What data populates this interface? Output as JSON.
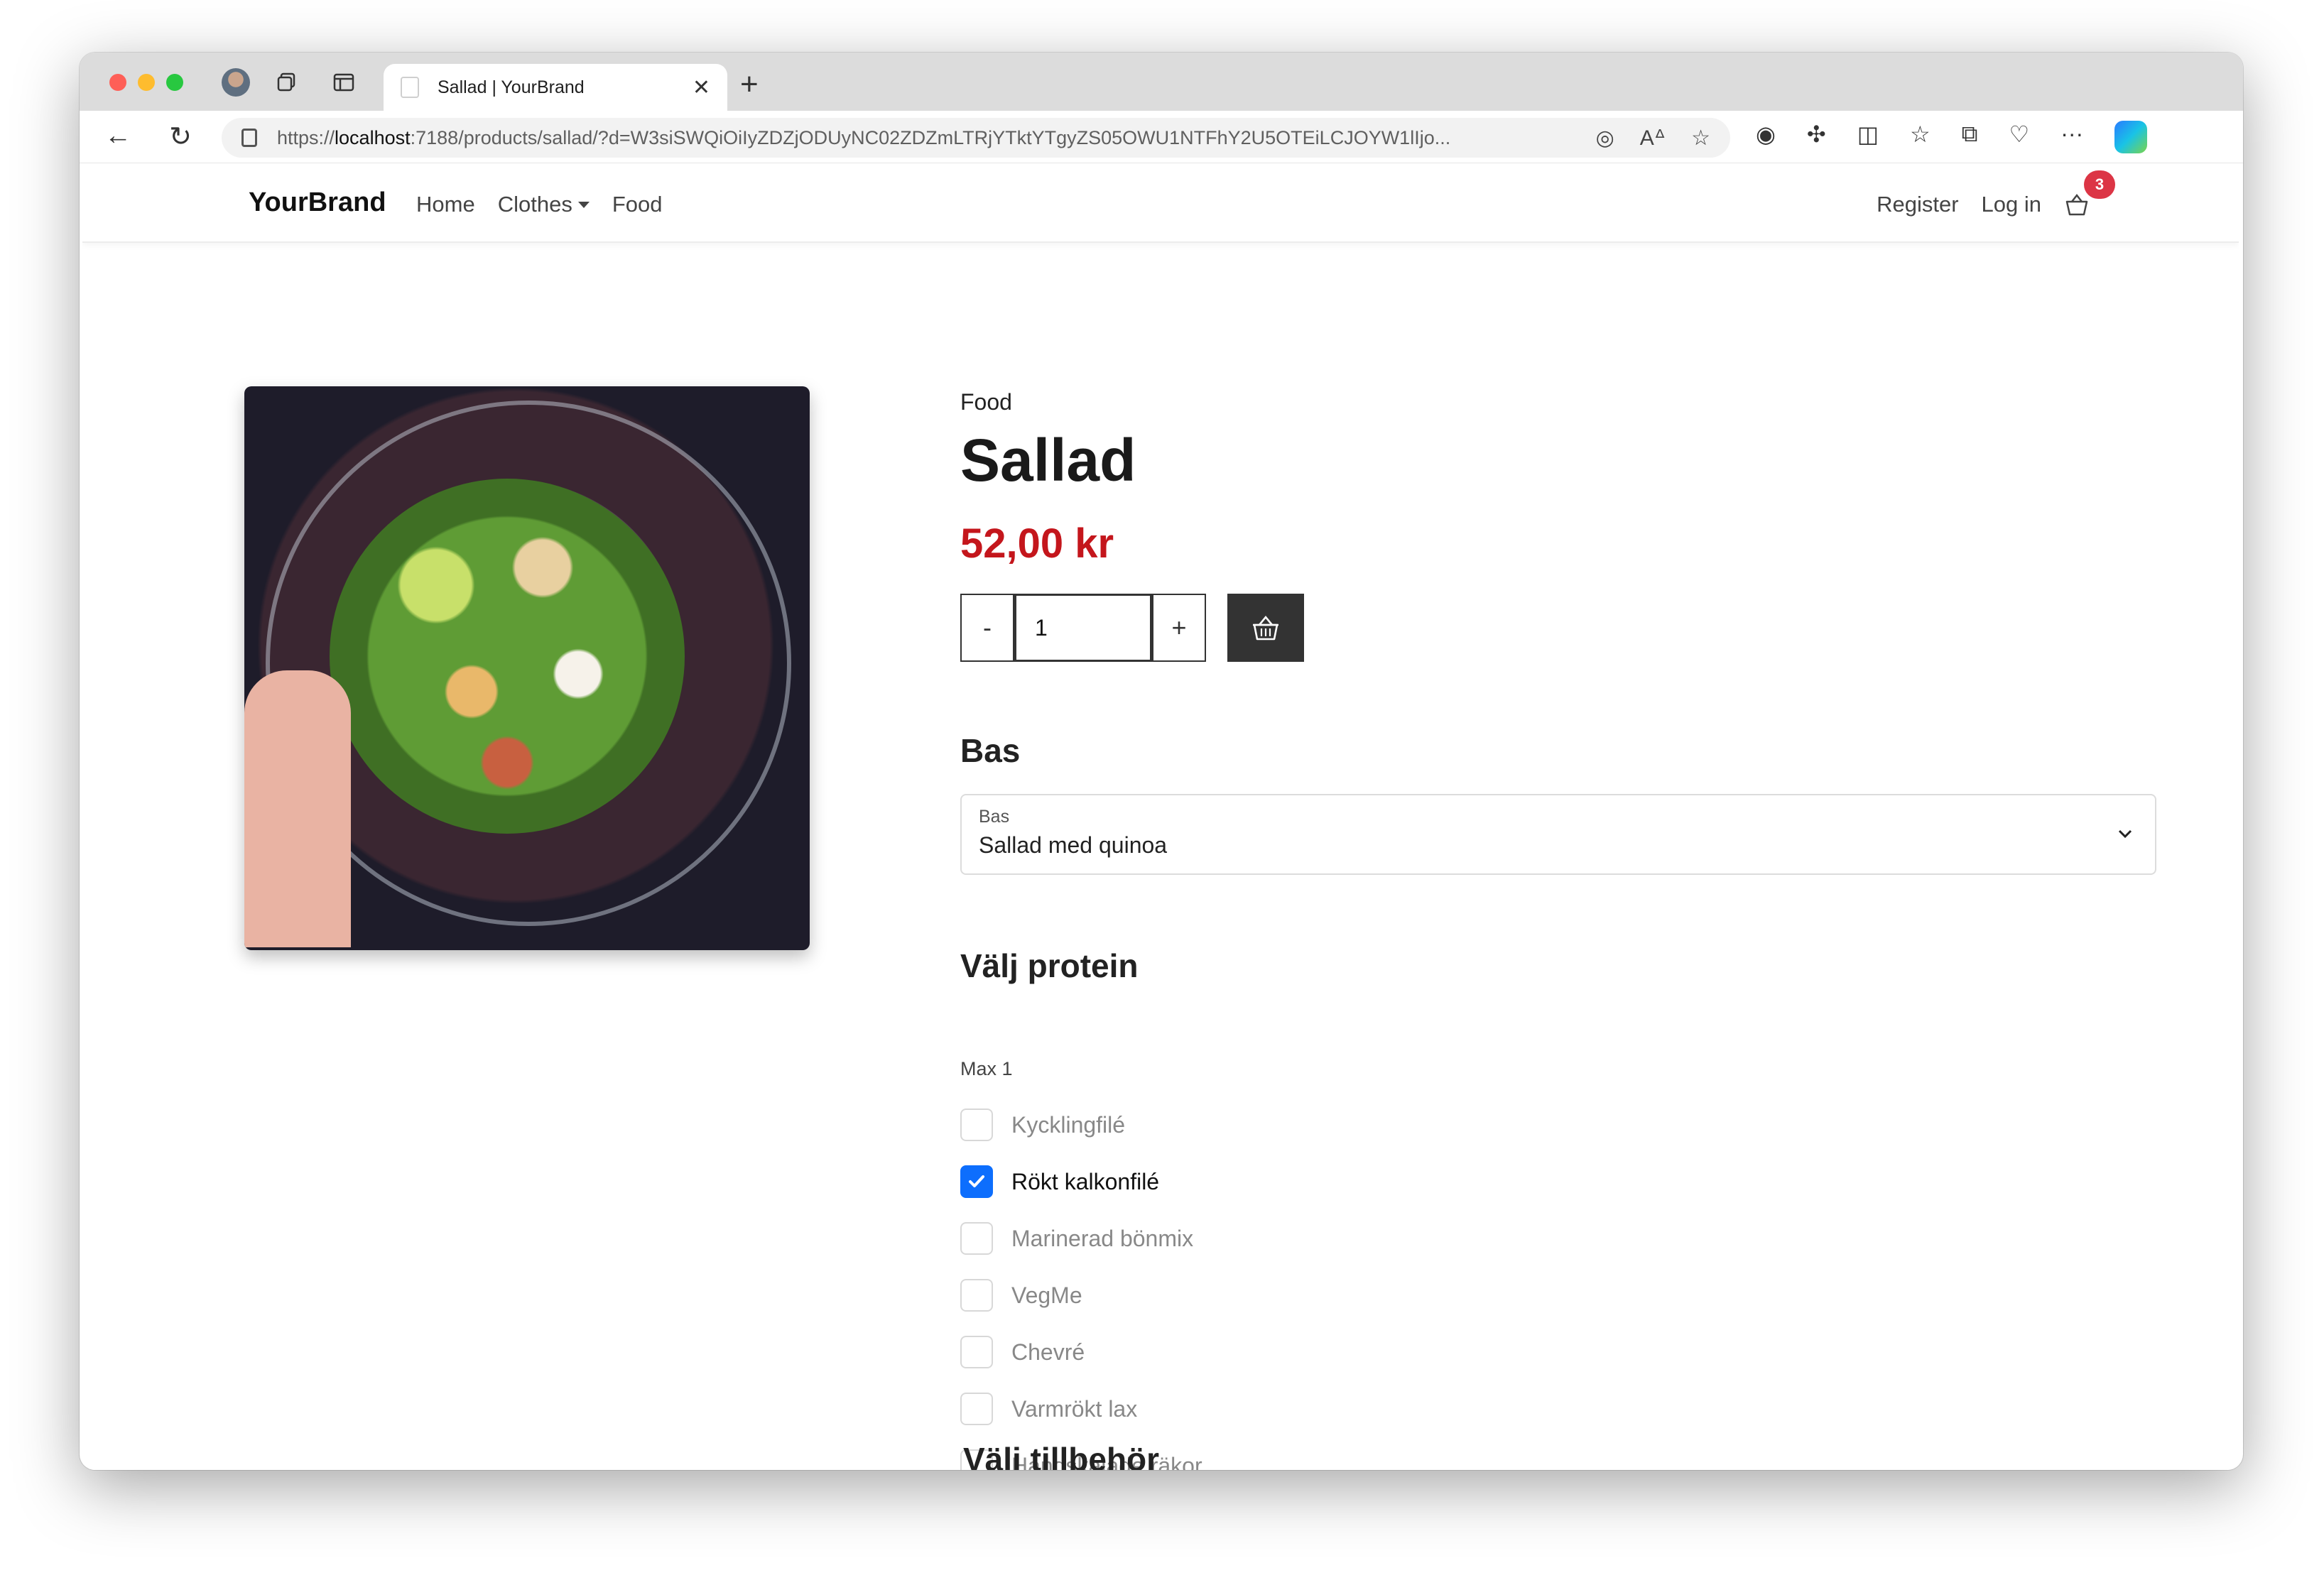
{
  "browser": {
    "tab_title": "Sallad | YourBrand",
    "url_prefix": "https://",
    "url_host": "localhost",
    "url_rest": ":7188/products/sallad/?d=W3siSWQiOiIyZDZjODUyNC02ZDZmLTRjYTktYTgyZS05OWU1NTFhY2U5OTEiLCJOYW1lIjo..."
  },
  "nav": {
    "brand": "YourBrand",
    "links": [
      "Home",
      "Clothes",
      "Food"
    ],
    "register": "Register",
    "login": "Log in",
    "cart_count": "3"
  },
  "product": {
    "category": "Food",
    "title": "Sallad",
    "price": "52,00 kr",
    "quantity_minus": "-",
    "quantity": "1",
    "quantity_plus": "+"
  },
  "bas": {
    "heading": "Bas",
    "select_label": "Bas",
    "select_value": "Sallad med quinoa"
  },
  "protein": {
    "heading": "Välj protein",
    "max_note": "Max 1",
    "options": [
      {
        "label": "Kycklingfilé",
        "checked": false
      },
      {
        "label": "Rökt kalkonfilé",
        "checked": true
      },
      {
        "label": "Marinerad bönmix",
        "checked": false
      },
      {
        "label": "VegMe",
        "checked": false
      },
      {
        "label": "Chevré",
        "checked": false
      },
      {
        "label": "Varmrökt lax",
        "checked": false
      },
      {
        "label": "Handskalade räkor",
        "checked": false
      }
    ]
  },
  "accessories": {
    "heading": "Välj tillbehör"
  },
  "colors": {
    "price": "#c4161c",
    "checkbox_checked": "#0d6efd",
    "cart_badge": "#dc3545",
    "add_to_cart": "#333333"
  }
}
